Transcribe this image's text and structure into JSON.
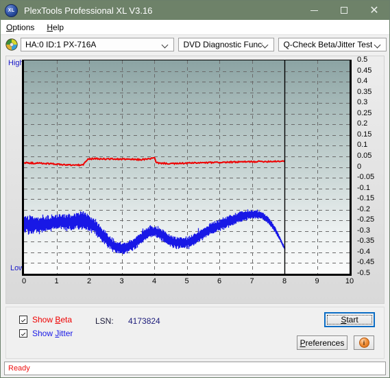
{
  "window": {
    "title": "PlexTools Professional XL V3.16",
    "app_icon": "xl-app-icon",
    "minimize": "—",
    "maximize": "□",
    "close": "✕",
    "titlebar_color": "#6e8269"
  },
  "menubar": {
    "items": [
      {
        "label": "Options",
        "accel": "O",
        "rest": "ptions"
      },
      {
        "label": "Help",
        "accel": "H",
        "rest": "elp"
      }
    ]
  },
  "toolbar": {
    "disc_icon": "cd-disc-icon",
    "drive_combo": {
      "value": "HA:0 ID:1  PX-716A"
    },
    "function_combo": {
      "value": "DVD Diagnostic Functions"
    },
    "test_combo": {
      "value": "Q-Check Beta/Jitter Test"
    }
  },
  "chart_data": {
    "type": "line",
    "title": "Q-Check Beta/Jitter Test",
    "xlabel": "",
    "ylabel": "",
    "xlim": [
      0,
      10
    ],
    "ylim": [
      -0.5,
      0.5
    ],
    "grid": true,
    "axis_hint_top": "High",
    "axis_hint_bottom": "Low",
    "x_ticks": [
      "0",
      "1",
      "2",
      "3",
      "4",
      "5",
      "6",
      "7",
      "8",
      "9",
      "10"
    ],
    "y_ticks": [
      "0.5",
      "0.45",
      "0.4",
      "0.35",
      "0.3",
      "0.25",
      "0.2",
      "0.15",
      "0.1",
      "0.05",
      "0",
      "-0.05",
      "-0.1",
      "-0.15",
      "-0.2",
      "-0.25",
      "-0.3",
      "-0.35",
      "-0.4",
      "-0.45",
      "-0.5"
    ],
    "data_end_x": 8,
    "series": [
      {
        "name": "Beta",
        "color": "#ee0000",
        "x": [
          0.0,
          0.15,
          0.3,
          0.45,
          0.6,
          0.75,
          0.9,
          1.05,
          1.2,
          1.35,
          1.5,
          1.65,
          1.8,
          1.95,
          2.05,
          2.1,
          2.25,
          2.4,
          2.55,
          2.7,
          2.85,
          3.0,
          3.15,
          3.3,
          3.45,
          3.6,
          3.75,
          3.9,
          4.0,
          4.05,
          4.2,
          4.35,
          4.5,
          4.65,
          4.8,
          4.95,
          5.1,
          5.25,
          5.4,
          5.55,
          5.7,
          5.85,
          6.0,
          6.15,
          6.3,
          6.45,
          6.6,
          6.75,
          6.9,
          7.05,
          7.2,
          7.35,
          7.5,
          7.65,
          7.8,
          7.95,
          8.0
        ],
        "y": [
          0.02,
          0.019,
          0.018,
          0.018,
          0.017,
          0.016,
          0.015,
          0.013,
          0.011,
          0.01,
          0.009,
          0.009,
          0.01,
          0.036,
          0.038,
          0.039,
          0.039,
          0.038,
          0.038,
          0.038,
          0.037,
          0.037,
          0.036,
          0.036,
          0.035,
          0.035,
          0.037,
          0.04,
          0.043,
          0.02,
          0.018,
          0.017,
          0.016,
          0.016,
          0.017,
          0.018,
          0.019,
          0.019,
          0.02,
          0.02,
          0.021,
          0.021,
          0.022,
          0.022,
          0.023,
          0.023,
          0.024,
          0.024,
          0.025,
          0.025,
          0.026,
          0.026,
          0.026,
          0.027,
          0.027,
          0.028,
          0.028
        ]
      },
      {
        "name": "Jitter",
        "color": "#1818e6",
        "x": [
          0.0,
          0.1,
          0.2,
          0.3,
          0.4,
          0.5,
          0.6,
          0.7,
          0.8,
          0.9,
          1.0,
          1.1,
          1.2,
          1.3,
          1.4,
          1.5,
          1.6,
          1.7,
          1.8,
          1.9,
          2.0,
          2.1,
          2.2,
          2.3,
          2.4,
          2.5,
          2.6,
          2.7,
          2.8,
          2.9,
          3.0,
          3.1,
          3.2,
          3.3,
          3.4,
          3.5,
          3.6,
          3.7,
          3.8,
          3.9,
          4.0,
          4.1,
          4.2,
          4.3,
          4.4,
          4.5,
          4.6,
          4.7,
          4.8,
          4.9,
          5.0,
          5.1,
          5.2,
          5.3,
          5.4,
          5.5,
          5.6,
          5.7,
          5.8,
          5.9,
          6.0,
          6.1,
          6.2,
          6.3,
          6.4,
          6.5,
          6.6,
          6.7,
          6.8,
          6.9,
          7.0,
          7.1,
          7.2,
          7.3,
          7.4,
          7.5,
          7.6,
          7.7,
          7.8,
          7.9,
          8.0
        ],
        "y_center": [
          -0.265,
          -0.27,
          -0.272,
          -0.272,
          -0.27,
          -0.268,
          -0.266,
          -0.264,
          -0.262,
          -0.26,
          -0.258,
          -0.257,
          -0.256,
          -0.256,
          -0.257,
          -0.258,
          -0.255,
          -0.25,
          -0.248,
          -0.255,
          -0.262,
          -0.272,
          -0.285,
          -0.3,
          -0.318,
          -0.335,
          -0.35,
          -0.362,
          -0.372,
          -0.378,
          -0.382,
          -0.38,
          -0.374,
          -0.366,
          -0.356,
          -0.344,
          -0.33,
          -0.318,
          -0.308,
          -0.303,
          -0.3,
          -0.305,
          -0.315,
          -0.326,
          -0.336,
          -0.344,
          -0.35,
          -0.354,
          -0.356,
          -0.356,
          -0.354,
          -0.348,
          -0.34,
          -0.33,
          -0.32,
          -0.31,
          -0.3,
          -0.292,
          -0.284,
          -0.278,
          -0.272,
          -0.266,
          -0.26,
          -0.253,
          -0.246,
          -0.24,
          -0.234,
          -0.23,
          -0.226,
          -0.223,
          -0.221,
          -0.221,
          -0.223,
          -0.228,
          -0.238,
          -0.252,
          -0.27,
          -0.292,
          -0.32,
          -0.352,
          -0.382
        ],
        "band_halfwidth": [
          0.03,
          0.032,
          0.032,
          0.031,
          0.03,
          0.03,
          0.029,
          0.029,
          0.029,
          0.029,
          0.028,
          0.028,
          0.029,
          0.03,
          0.031,
          0.03,
          0.03,
          0.033,
          0.035,
          0.031,
          0.029,
          0.028,
          0.027,
          0.026,
          0.026,
          0.025,
          0.024,
          0.023,
          0.022,
          0.021,
          0.021,
          0.021,
          0.021,
          0.022,
          0.022,
          0.022,
          0.021,
          0.021,
          0.021,
          0.021,
          0.02,
          0.021,
          0.021,
          0.021,
          0.021,
          0.021,
          0.021,
          0.021,
          0.021,
          0.021,
          0.021,
          0.021,
          0.021,
          0.021,
          0.021,
          0.021,
          0.021,
          0.021,
          0.022,
          0.022,
          0.022,
          0.022,
          0.022,
          0.021,
          0.021,
          0.021,
          0.02,
          0.02,
          0.019,
          0.018,
          0.017,
          0.016,
          0.015,
          0.014,
          0.013,
          0.012,
          0.011,
          0.01,
          0.009,
          0.008,
          0.007
        ]
      }
    ]
  },
  "controls": {
    "show_beta": {
      "label": "Show Beta",
      "pre": "Show ",
      "accel": "B",
      "post": "eta",
      "checked": true,
      "color": "#ee0000"
    },
    "show_jitter": {
      "label": "Show Jitter",
      "pre": "Show ",
      "accel": "J",
      "post": "itter",
      "checked": true,
      "color": "#1818e6"
    },
    "lsn_label": "LSN:",
    "lsn_value": "4173824",
    "start_button": {
      "label": "Start",
      "accel": "S",
      "rest": "tart",
      "focused": true
    },
    "preferences_button": {
      "label": "Preferences",
      "accel": "P",
      "rest": "references"
    },
    "info_button": {
      "icon": "info-icon",
      "glyph": "i"
    }
  },
  "statusbar": {
    "text": "Ready",
    "color": "#ee1111"
  }
}
